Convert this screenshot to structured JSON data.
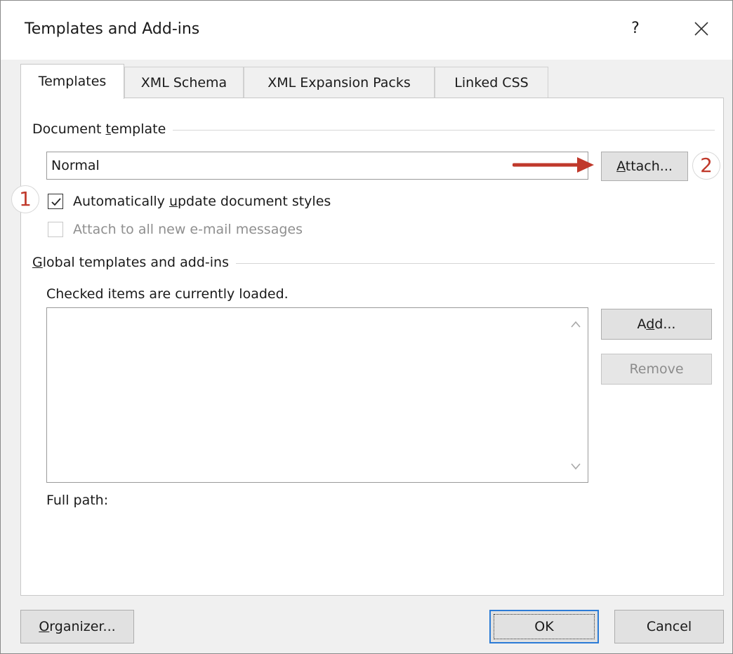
{
  "window": {
    "title": "Templates and Add-ins",
    "help_label": "?",
    "close_icon": "close-icon"
  },
  "tabs": [
    {
      "label": "Templates",
      "active": true
    },
    {
      "label": "XML Schema",
      "active": false
    },
    {
      "label": "XML Expansion Packs",
      "active": false
    },
    {
      "label": "Linked CSS",
      "active": false
    }
  ],
  "document_template": {
    "group_label_pre": "Document ",
    "group_label_accel": "t",
    "group_label_post": "emplate",
    "value": "Normal",
    "attach_pre": "",
    "attach_accel": "A",
    "attach_post": "ttach...",
    "auto_update_pre": "Automatically ",
    "auto_update_accel": "u",
    "auto_update_post": "pdate document styles",
    "auto_update_checked": true,
    "attach_email_label": "Attach to all new e-mail messages",
    "attach_email_checked": false,
    "attach_email_enabled": false
  },
  "global_templates": {
    "group_label_accel": "G",
    "group_label_post": "lobal templates and add-ins",
    "hint": "Checked items are currently loaded.",
    "items": [],
    "add_pre": "A",
    "add_accel": "d",
    "add_post": "d...",
    "remove_label": "Remove",
    "full_path_label": "Full path:"
  },
  "footer": {
    "organizer_accel": "O",
    "organizer_post": "rganizer...",
    "ok_label": "OK",
    "cancel_label": "Cancel"
  },
  "annotations": {
    "badge_1": "1",
    "badge_2": "2",
    "arrow_color": "#c0392b"
  }
}
